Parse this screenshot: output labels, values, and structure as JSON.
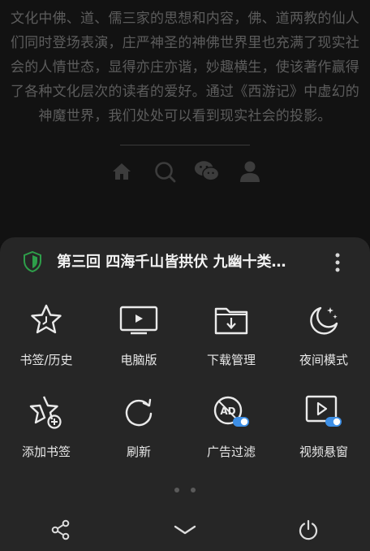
{
  "article": {
    "text": "文化中佛、道、儒三家的思想和内容，佛、道两教的仙人们同时登场表演，庄严神圣的神佛世界里也充满了现实社会的人情世态，显得亦庄亦谐，妙趣横生，使该著作赢得了各种文化层次的读者的爱好。通过《西游记》中虚幻的神魔世界，我们处处可以看到现实社会的投影。",
    "footer_icons": [
      "home-icon",
      "search-icon",
      "wechat-icon",
      "user-icon"
    ]
  },
  "sheet": {
    "title": "第三回 四海千山皆拱伏 九幽十类…",
    "shield_icon": "shield-icon",
    "more_icon": "more-vertical-icon",
    "tiles": [
      {
        "label": "书签/历史",
        "icon": "star-clock-icon"
      },
      {
        "label": "电脑版",
        "icon": "desktop-icon"
      },
      {
        "label": "下载管理",
        "icon": "download-folder-icon"
      },
      {
        "label": "夜间模式",
        "icon": "moon-stars-icon"
      },
      {
        "label": "添加书签",
        "icon": "star-add-icon"
      },
      {
        "label": "刷新",
        "icon": "refresh-icon"
      },
      {
        "label": "广告过滤",
        "icon": "ad-filter-icon"
      },
      {
        "label": "视频悬窗",
        "icon": "video-float-icon"
      }
    ],
    "page_dots": 2
  },
  "bottom_bar": {
    "icons": [
      "share-icon",
      "collapse-chevron-icon",
      "power-icon"
    ]
  },
  "colors": {
    "sheet_bg": "#262626",
    "page_bg": "#101010",
    "toggle_accent": "#3d8fe6",
    "shield_green": "#2e9e4a"
  }
}
